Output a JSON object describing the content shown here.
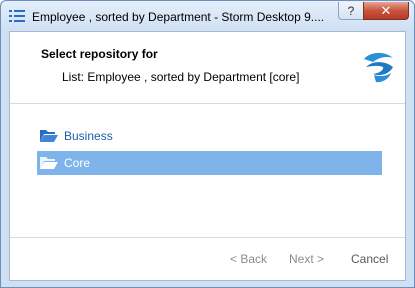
{
  "window": {
    "title": "Employee , sorted by Department -  Storm Desktop 9....",
    "help_label": "?",
    "close_label": "✕"
  },
  "header": {
    "title": "Select repository for",
    "subtitle": "List: Employee , sorted by Department [core]"
  },
  "repositories": [
    {
      "label": "Business",
      "selected": false
    },
    {
      "label": "Core",
      "selected": true
    }
  ],
  "buttons": {
    "back": "< Back",
    "next": "Next >",
    "cancel": "Cancel"
  },
  "colors": {
    "selection": "#7eb4ea",
    "link_text": "#1e5da8",
    "folder": "#2a6cc4",
    "logo": "#2a8fd6"
  },
  "icons": {
    "title": "list-icon",
    "logo": "storm-logo-icon",
    "repository": "folder-open-icon"
  }
}
